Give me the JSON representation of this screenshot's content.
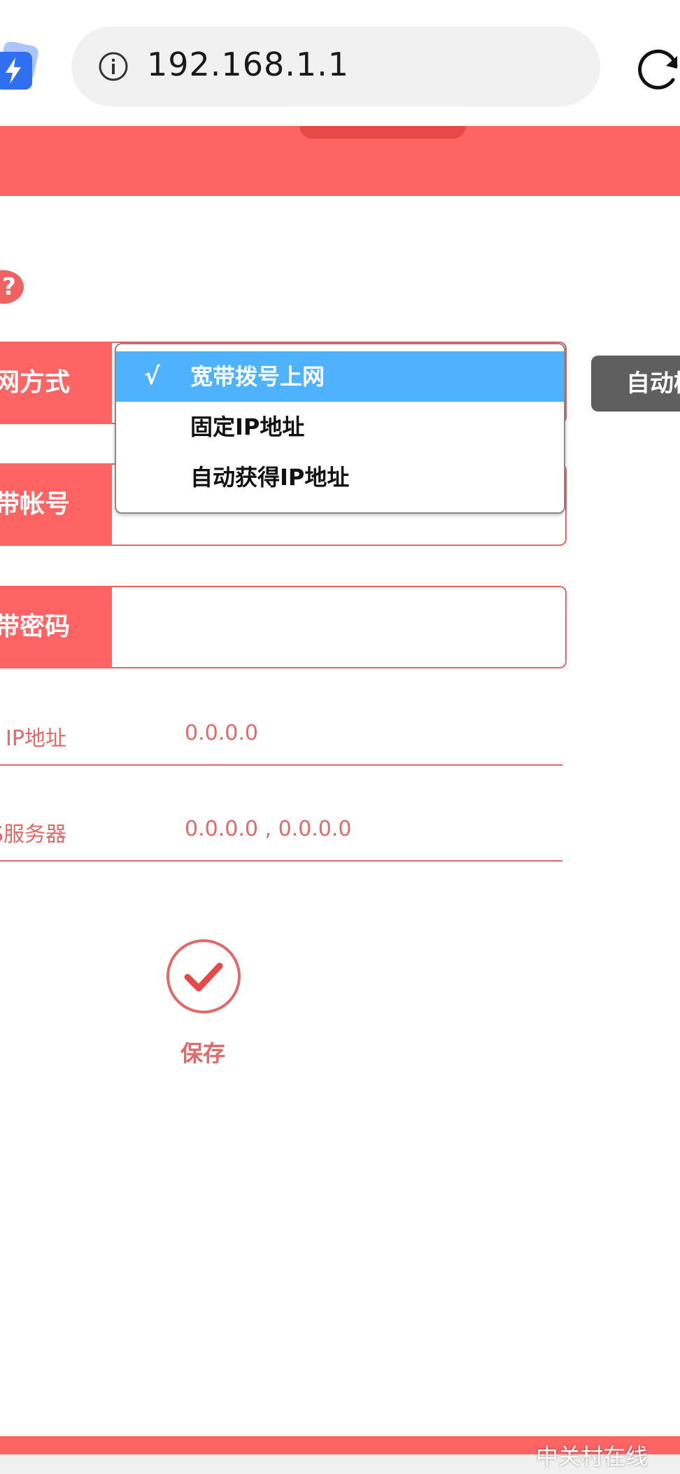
{
  "browser": {
    "url": "192.168.1.1"
  },
  "form": {
    "mode_label": "网方式",
    "account_label": "带帐号",
    "password_label": "带密码",
    "auto_button": "自动检",
    "dropdown": {
      "options": [
        "宽带拨号上网",
        "固定IP地址",
        "自动获得IP地址"
      ],
      "selected_index": 0,
      "check": "√"
    }
  },
  "info": {
    "ip_label": "IP地址",
    "ip_value": "0.0.0.0",
    "dns_label": "S服务器",
    "dns_value": "0.0.0.0 , 0.0.0.0"
  },
  "save": {
    "label": "保存"
  },
  "watermark": "中关村在线",
  "colors": {
    "accent": "#ff6464",
    "text_accent": "#e06a6a",
    "dropdown_selected": "#4fb2ff"
  }
}
